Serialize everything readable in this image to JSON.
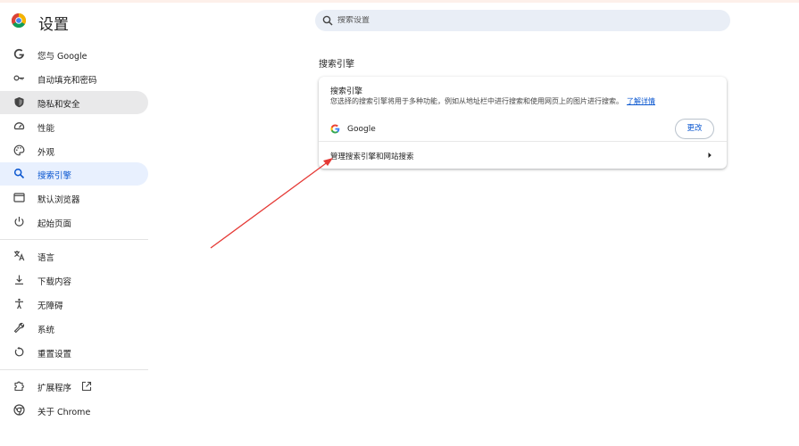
{
  "app": {
    "title": "设置",
    "logo_icon": "chrome-logo-icon"
  },
  "search": {
    "placeholder": "搜索设置",
    "value": ""
  },
  "sidebar": {
    "items": [
      {
        "label": "您与 Google",
        "icon": "google-g-icon"
      },
      {
        "label": "自动填充和密码",
        "icon": "key-icon"
      },
      {
        "label": "隐私和安全",
        "icon": "shield-icon"
      },
      {
        "label": "性能",
        "icon": "speedometer-icon"
      },
      {
        "label": "外观",
        "icon": "palette-icon"
      },
      {
        "label": "搜索引擎",
        "icon": "search-icon"
      },
      {
        "label": "默认浏览器",
        "icon": "browser-window-icon"
      },
      {
        "label": "起始页面",
        "icon": "power-icon"
      },
      {
        "label": "语言",
        "icon": "translate-icon"
      },
      {
        "label": "下载内容",
        "icon": "download-icon"
      },
      {
        "label": "无障碍",
        "icon": "accessibility-icon"
      },
      {
        "label": "系统",
        "icon": "wrench-icon"
      },
      {
        "label": "重置设置",
        "icon": "reset-icon"
      },
      {
        "label": "扩展程序",
        "icon": "puzzle-icon"
      },
      {
        "label": "关于 Chrome",
        "icon": "chrome-icon"
      }
    ],
    "active_item": "搜索引擎"
  },
  "main": {
    "section_title": "搜索引擎",
    "card": {
      "heading": "搜索引擎",
      "description": "您选择的搜索引擎将用于多种功能，例如从地址栏中进行搜索和使用网页上的图片进行搜索。",
      "learn_more": "了解详情",
      "engine_name": "Google",
      "change_button": "更改",
      "manage_label": "管理搜索引擎和网站搜索"
    }
  },
  "colors": {
    "accent": "#0b57d0",
    "active_bg": "#e8f0fe",
    "annotation_arrow": "#e53935"
  }
}
